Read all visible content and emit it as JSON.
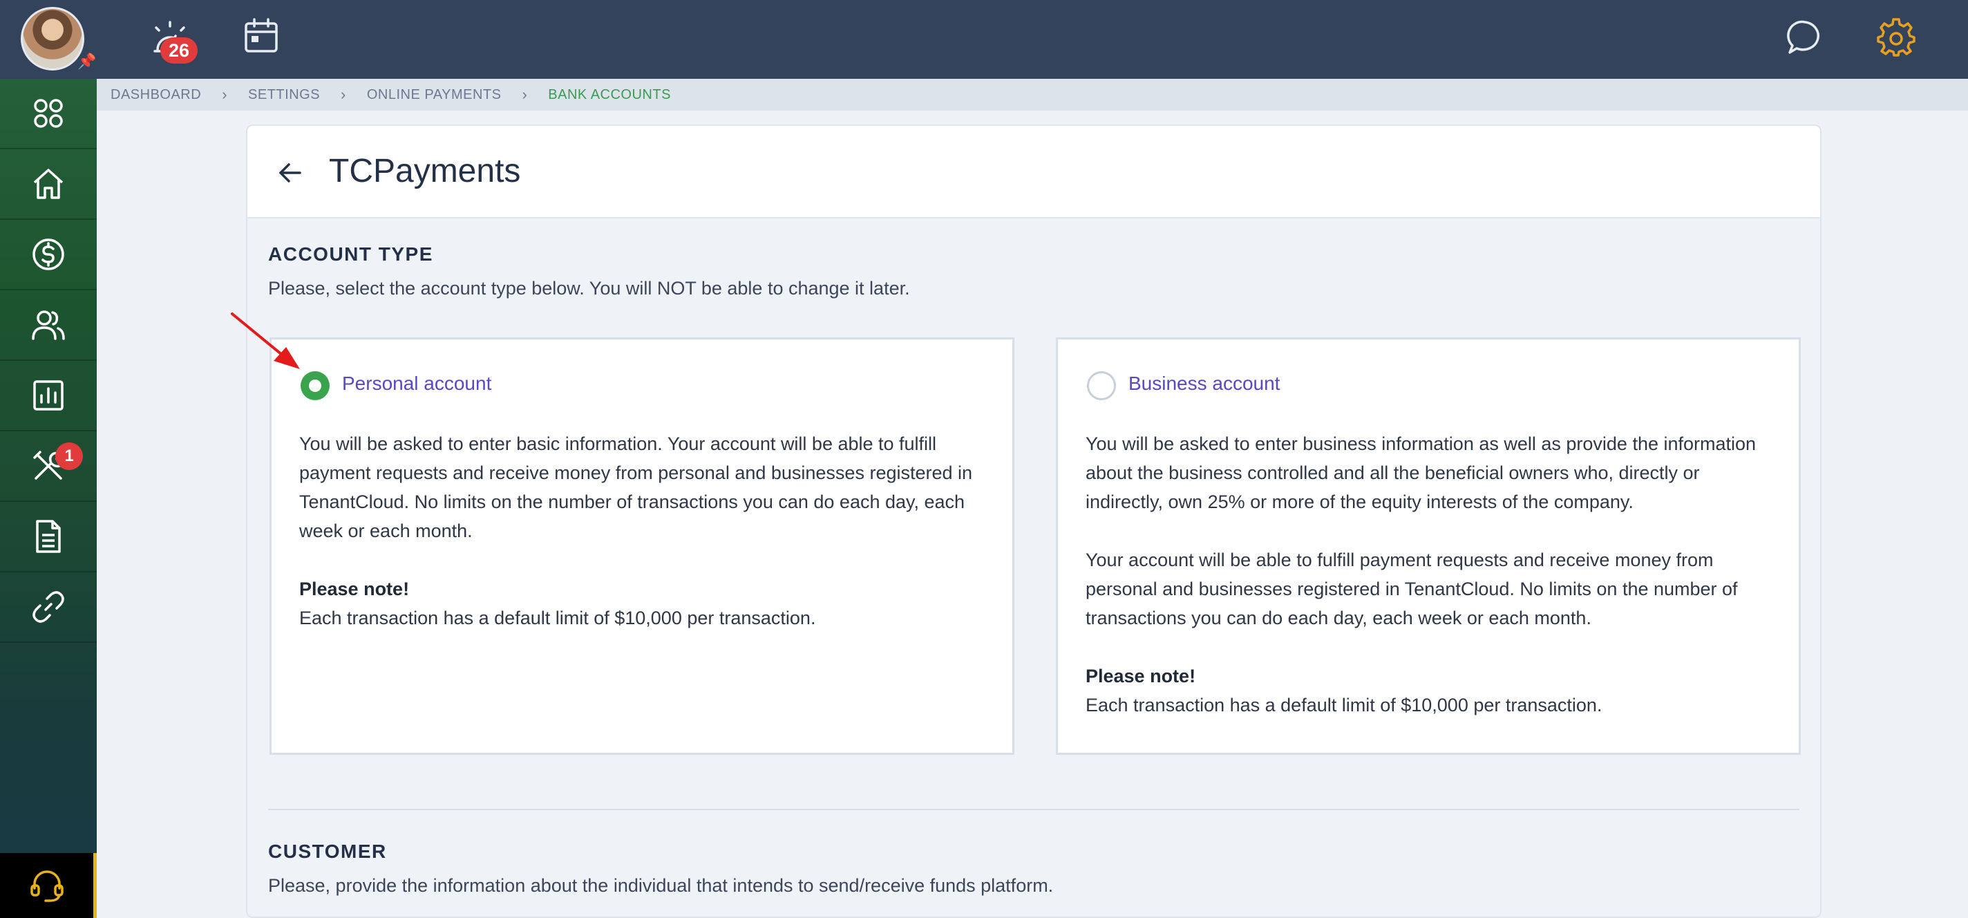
{
  "colors": {
    "topbar": "#33435b",
    "accent_green": "#3a9b4e",
    "badge_red": "#e23b3b",
    "link_purple": "#5648c8",
    "gear_orange": "#e8a020"
  },
  "topbar": {
    "notifications_count": "26",
    "icons": [
      "avatar",
      "pin-icon",
      "alarm-icon",
      "calendar-icon",
      "chat-icon",
      "gear-icon"
    ]
  },
  "sidebar": {
    "items": [
      {
        "icon": "apps-grid-icon"
      },
      {
        "icon": "home-icon"
      },
      {
        "icon": "dollar-icon"
      },
      {
        "icon": "users-icon"
      },
      {
        "icon": "reports-icon"
      },
      {
        "icon": "tools-icon",
        "badge": "1"
      },
      {
        "icon": "document-icon"
      },
      {
        "icon": "link-icon"
      }
    ],
    "support_icon": "headset-icon"
  },
  "breadcrumb": {
    "items": [
      "DASHBOARD",
      "SETTINGS",
      "ONLINE PAYMENTS",
      "BANK ACCOUNTS"
    ]
  },
  "page": {
    "title": "TCPayments"
  },
  "account_type": {
    "title": "ACCOUNT TYPE",
    "subtitle": "Please, select the account type below. You will NOT be able to change it later.",
    "options": [
      {
        "label": "Personal account",
        "selected": true,
        "paragraphs": [
          "You will be asked to enter basic information. Your account will be able to fulfill payment requests and receive money from personal and businesses registered in TenantCloud. No limits on the number of transactions you can do each day, each week or each month."
        ],
        "note_title": "Please note!",
        "note_text": "Each transaction has a default limit of $10,000 per transaction."
      },
      {
        "label": "Business account",
        "selected": false,
        "paragraphs": [
          "You will be asked to enter business information as well as provide the information about the business controlled and all the beneficial owners who, directly or indirectly, own 25% or more of the equity interests of the company.",
          "Your account will be able to fulfill payment requests and receive money from personal and businesses registered in TenantCloud. No limits on the number of transactions you can do each day, each week or each month."
        ],
        "note_title": "Please note!",
        "note_text": "Each transaction has a default limit of $10,000 per transaction."
      }
    ]
  },
  "customer": {
    "title": "CUSTOMER",
    "subtitle": "Please, provide the information about the individual that intends to send/receive funds platform."
  }
}
